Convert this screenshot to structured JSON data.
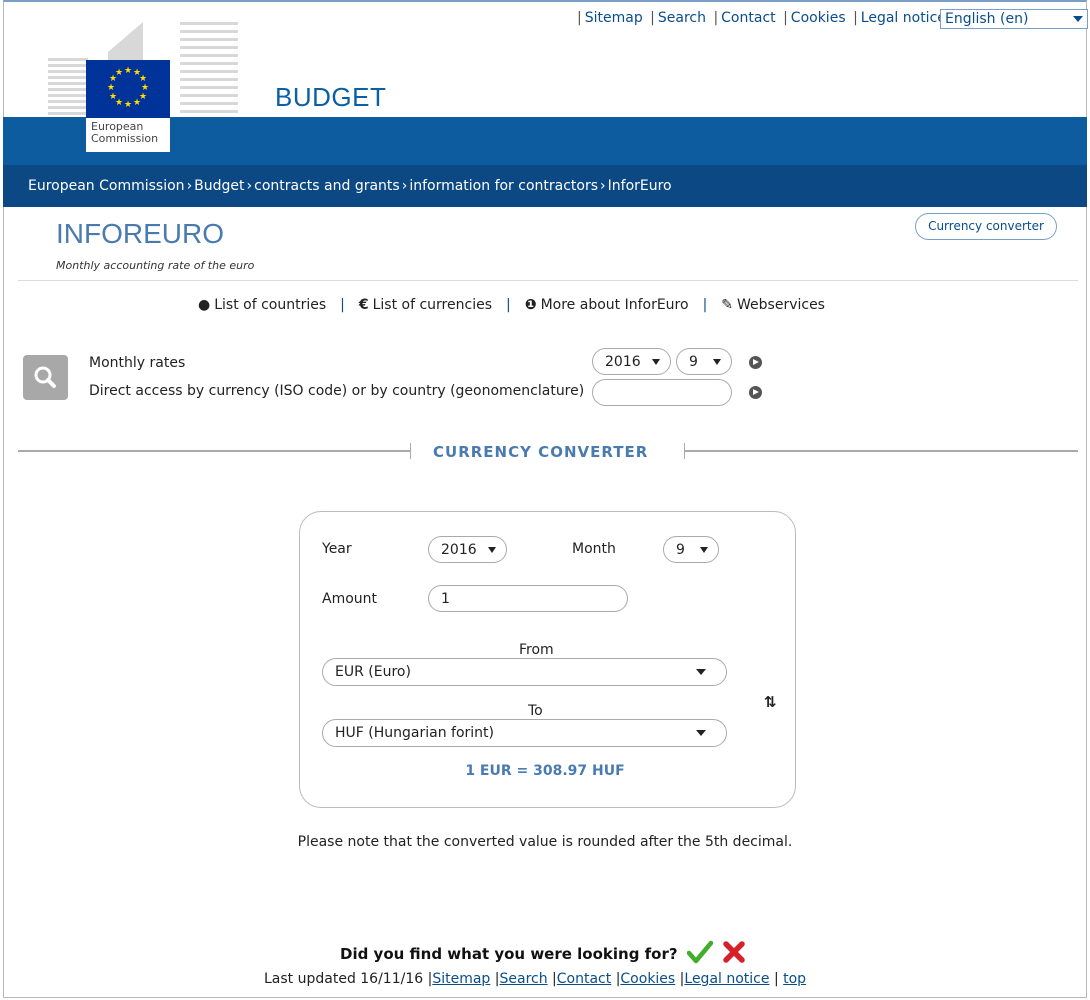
{
  "top_links": [
    "Sitemap",
    "Search",
    "Contact",
    "Cookies",
    "Legal notice"
  ],
  "language": "English (en)",
  "header": {
    "org_line1": "European",
    "org_line2": "Commission",
    "site_title": "BUDGET"
  },
  "breadcrumb": [
    "European Commission",
    "Budget",
    "contracts and grants",
    "information for contractors",
    "InforEuro"
  ],
  "page": {
    "title": "INFOREURO",
    "subtitle": "Monthly accounting rate of the euro",
    "converter_button": "Currency converter"
  },
  "quick_links": [
    {
      "icon": "globe-icon",
      "label": "List of countries"
    },
    {
      "icon": "euro-icon",
      "label": "List of currencies"
    },
    {
      "icon": "info-icon",
      "label": "More about InforEuro"
    },
    {
      "icon": "wrench-icon",
      "label": "Webservices"
    }
  ],
  "search": {
    "monthly_label": "Monthly rates",
    "direct_label": "Direct access by currency (ISO code) or by country (geonomenclature)",
    "year": "2016",
    "month": "9",
    "direct_value": ""
  },
  "converter": {
    "heading": "CURRENCY CONVERTER",
    "year_label": "Year",
    "year": "2016",
    "month_label": "Month",
    "month": "9",
    "amount_label": "Amount",
    "amount": "1",
    "from_label": "From",
    "from": "EUR (Euro)",
    "to_label": "To",
    "to": "HUF (Hungarian forint)",
    "result": "1 EUR = 308.97 HUF"
  },
  "note": "Please note that the converted value is rounded after the 5th decimal.",
  "feedback": "Did you find what you were looking for?",
  "footer": {
    "updated": "Last updated 16/11/16",
    "links": [
      "Sitemap",
      "Search",
      "Contact",
      "Cookies",
      "Legal notice"
    ],
    "top": "top"
  },
  "colors": {
    "brand_blue": "#0c5c9f",
    "breadcrumb_bg": "#0b4884",
    "accent": "#4a7bb0",
    "flag": "#003399"
  }
}
